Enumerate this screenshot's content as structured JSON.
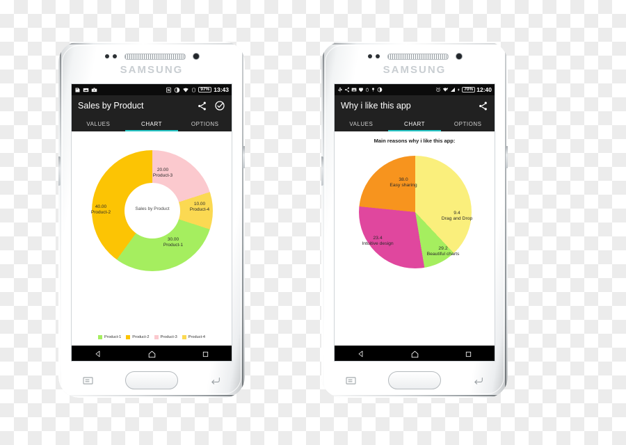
{
  "scene": {
    "background": "transparent-checkerboard",
    "device_brand": "SAMSUNG"
  },
  "phones": [
    {
      "id": "phone-left",
      "brand": "SAMSUNG",
      "status_bar": {
        "left_icons": [
          "sdcard-icon",
          "screenshot-icon",
          "briefcase-icon"
        ],
        "right_icons": [
          "nfc-icon",
          "contrast-icon",
          "wifi-icon",
          "sim-icon"
        ],
        "battery": "97%",
        "time": "13:43"
      },
      "app_bar": {
        "title": "Sales by Product",
        "actions": [
          "share-icon",
          "check-circle-icon"
        ]
      },
      "tabs": [
        {
          "label": "VALUES",
          "active": false
        },
        {
          "label": "CHART",
          "active": true
        },
        {
          "label": "OPTIONS",
          "active": false
        }
      ],
      "nav_bar": [
        "back-icon",
        "home-icon",
        "recents-icon"
      ],
      "chart_data": {
        "type": "pie",
        "variant": "donut",
        "title": "Sales by Product",
        "center_label": "Sales by Product",
        "legend_position": "bottom",
        "categories": [
          "Product-1",
          "Product-2",
          "Product-3",
          "Product-4"
        ],
        "values": [
          30.0,
          40.0,
          20.0,
          10.0
        ],
        "value_labels": [
          "30.00",
          "40.00",
          "20.00",
          "10.00"
        ],
        "colors": [
          "#A5EE5F",
          "#FCC404",
          "#FBC9CE",
          "#FBD952"
        ],
        "total": 100.0,
        "slices": [
          {
            "label": "Product-3",
            "value": "20.00",
            "color": "#FBC9CE",
            "start_deg": 0,
            "end_deg": 72
          },
          {
            "label": "Product-4",
            "value": "10.00",
            "color": "#FBD952",
            "start_deg": 72,
            "end_deg": 108
          },
          {
            "label": "Product-1",
            "value": "30.00",
            "color": "#A5EE5F",
            "start_deg": 108,
            "end_deg": 216
          },
          {
            "label": "Product-2",
            "value": "40.00",
            "color": "#FCC404",
            "start_deg": 216,
            "end_deg": 360
          }
        ],
        "legend": [
          {
            "label": "Product-1",
            "color": "#A5EE5F"
          },
          {
            "label": "Product-2",
            "color": "#FCC404"
          },
          {
            "label": "Product-3",
            "color": "#FBC9CE"
          },
          {
            "label": "Product-4",
            "color": "#FBD952"
          }
        ]
      }
    },
    {
      "id": "phone-right",
      "brand": "SAMSUNG",
      "status_bar": {
        "left_icons": [
          "usb-icon",
          "share-icon",
          "screenshot-icon",
          "heart-icon",
          "battery-saver-icon",
          "pin-icon",
          "contrast-icon"
        ],
        "right_icons": [
          "alarm-icon",
          "wifi-alert-icon",
          "signal-icon",
          "charging-icon"
        ],
        "battery": "70%",
        "time": "12:40"
      },
      "app_bar": {
        "title": "Why i like this app",
        "actions": [
          "share-icon"
        ]
      },
      "tabs": [
        {
          "label": "VALUES",
          "active": false
        },
        {
          "label": "CHART",
          "active": true
        },
        {
          "label": "OPTIONS",
          "active": false
        }
      ],
      "nav_bar": [
        "back-icon",
        "home-icon",
        "recents-icon"
      ],
      "chart_data": {
        "type": "pie",
        "variant": "pie",
        "title": "Main reasons why i like this app:",
        "legend_position": "none",
        "categories": [
          "Easy sharing",
          "Drag and Drop",
          "Beautiful charts",
          "Intuitive design"
        ],
        "values": [
          38.0,
          9.4,
          29.2,
          23.4
        ],
        "value_labels": [
          "38.0",
          "9.4",
          "29.2",
          "23.4"
        ],
        "colors": [
          "#FAEF7C",
          "#A5EE5F",
          "#E0479E",
          "#F7941E"
        ],
        "total": 100.0,
        "slices": [
          {
            "label": "Easy sharing",
            "value": "38.0",
            "color": "#FAEF7C",
            "start_deg": 0,
            "end_deg": 136.8
          },
          {
            "label": "Drag and Drop",
            "value": "9.4",
            "color": "#A5EE5F",
            "start_deg": 136.8,
            "end_deg": 170.6
          },
          {
            "label": "Beautiful charts",
            "value": "29.2",
            "color": "#E0479E",
            "start_deg": 170.6,
            "end_deg": 275.7
          },
          {
            "label": "Intuitive design",
            "value": "23.4",
            "color": "#F7941E",
            "start_deg": 275.7,
            "end_deg": 360
          }
        ]
      }
    }
  ],
  "theme": {
    "accent": "#26C6C6",
    "app_bar_bg": "#212121",
    "status_bar_bg": "#0B0B0B",
    "nav_bar_bg": "#000000",
    "screen_bg": "#FFFFFF"
  }
}
